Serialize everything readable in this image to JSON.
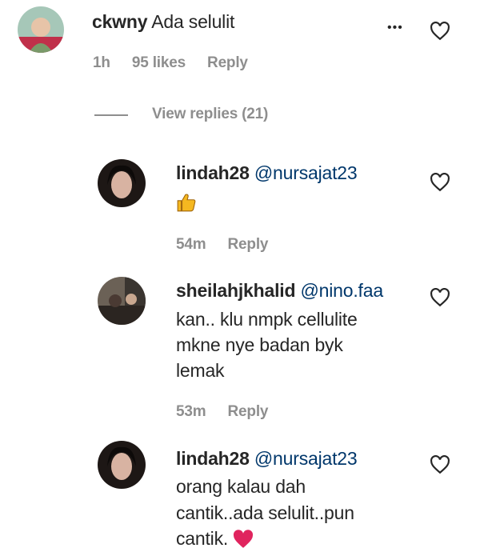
{
  "comment": {
    "username": "ckwny",
    "text": "Ada selulit",
    "time": "1h",
    "likes": "95 likes",
    "reply": "Reply",
    "more": "•••"
  },
  "view_replies": "View replies (21)",
  "replies": [
    {
      "username": "lindah28",
      "mention": "@nursajat23",
      "lines": [],
      "emoji": "thumbs-up-icon",
      "time": "54m",
      "reply": "Reply"
    },
    {
      "username": "sheilahjkhalid",
      "mention": "@nino.faa",
      "lines": [
        "kan.. klu nmpk cellulite",
        "mkne nye badan byk",
        "lemak"
      ],
      "time": "53m",
      "reply": "Reply"
    },
    {
      "username": "lindah28",
      "mention": "@nursajat23",
      "lines": [
        "orang kalau dah",
        "cantik..ada selulit..pun",
        "cantik."
      ],
      "emoji": "heart-icon"
    }
  ],
  "colors": {
    "text": "#262626",
    "mention": "#00376b",
    "meta": "#8e8e8e",
    "heart": "#e0245e",
    "thumb": "#f5b820"
  }
}
